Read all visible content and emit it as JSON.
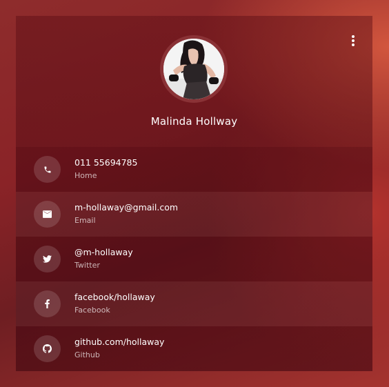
{
  "profile": {
    "name": "Malinda Hollway"
  },
  "contacts": [
    {
      "value": "011 55694785",
      "label": "Home",
      "icon": "phone-icon"
    },
    {
      "value": "m-hollaway@gmail.com",
      "label": "Email",
      "icon": "mail-icon"
    },
    {
      "value": "@m-hollaway",
      "label": "Twitter",
      "icon": "twitter-icon"
    },
    {
      "value": "facebook/hollaway",
      "label": "Facebook",
      "icon": "facebook-icon"
    },
    {
      "value": "github.com/hollaway",
      "label": "Github",
      "icon": "github-icon"
    }
  ],
  "colors": {
    "background": "#8a2327",
    "avatar_ring": "#8a3236",
    "text_primary": "#ffffff"
  }
}
